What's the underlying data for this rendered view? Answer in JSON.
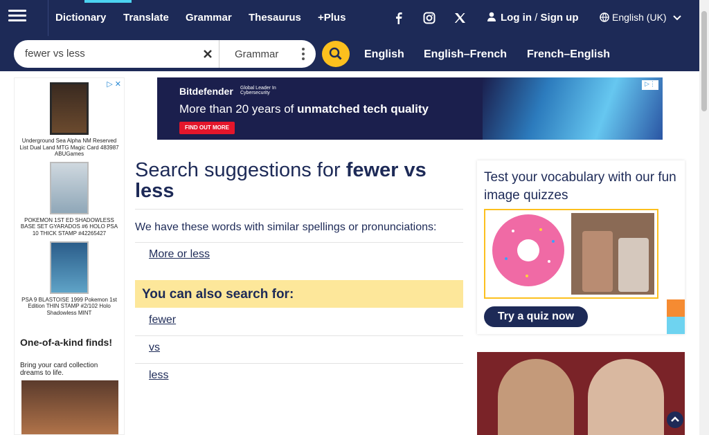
{
  "nav": {
    "links": [
      "Dictionary",
      "Translate",
      "Grammar",
      "Thesaurus",
      "+Plus"
    ],
    "login": "Log in",
    "slash": "/",
    "signup": "Sign up",
    "language": "English (UK)"
  },
  "search": {
    "query": "fewer vs less",
    "dictionary": "Grammar"
  },
  "tabs": [
    "English",
    "English–French",
    "French–English"
  ],
  "left_ad": {
    "items": [
      "Underground Sea Alpha NM Reserved List Dual Land MTG Magic Card 483987 ABUGames",
      "POKEMON 1ST ED SHADOWLESS BASE SET GYARADOS #6 HOLO PSA 10 THICK STAMP #42265427",
      "PSA 9 BLASTOISE 1999 Pokemon 1st Edition THIN STAMP #2/102 Holo Shadowless MINT"
    ],
    "promo_title": "One-of-a-kind finds!",
    "promo_sub": "Bring your card collection dreams to life."
  },
  "top_ad": {
    "brand": "Bitdefender",
    "brand_tag": "Global Leader In Cybersecurity",
    "headline_plain": "More than 20 years of",
    "headline_bold": "unmatched tech quality",
    "cta": "FIND OUT MORE"
  },
  "main": {
    "heading_prefix": "Search suggestions for",
    "heading_query": "fewer vs less",
    "similar_text": "We have these words with similar spellings or pronunciations:",
    "similar_links": [
      "More or less"
    ],
    "also_title": "You can also search for:",
    "also_links": [
      "fewer",
      "vs",
      "less"
    ]
  },
  "quiz": {
    "title": "Test your vocabulary with our fun image quizzes",
    "button": "Try a quiz now"
  },
  "colors": {
    "brand_navy": "#1d2a57",
    "accent_yellow": "#fcc01e",
    "highlight_bg": "#fde79a"
  }
}
